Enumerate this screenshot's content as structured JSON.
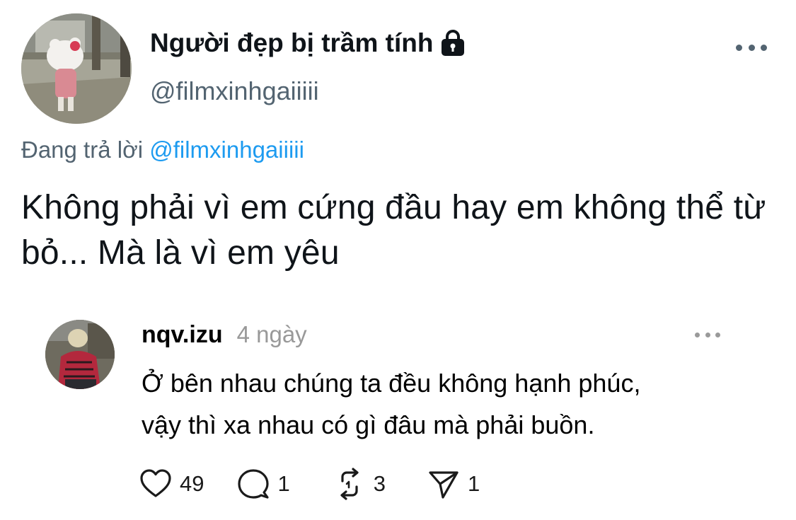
{
  "tweet": {
    "display_name": "Người đẹp bị trầm tính",
    "handle": "@filmxinhgaiiiii",
    "replying_prefix": "Đang trả lời",
    "replying_to": "@filmxinhgaiiiii",
    "text": "Không phải vì em cứng đầu hay em không thể từ bỏ... Mà là vì em yêu",
    "avatar_icon": "hello-kitty-photo",
    "protected_icon": "lock-icon",
    "more_icon": "more-horizontal-icon"
  },
  "embedded_reply": {
    "username": "nqv.izu",
    "time": "4 ngày",
    "text_line1": "Ở bên nhau chúng ta đều không hạnh phúc,",
    "text_line2": "vậy thì xa nhau có gì đâu mà phải buồn.",
    "avatar_icon": "person-photo",
    "actions": {
      "likes": "49",
      "comments": "1",
      "reposts": "3",
      "shares": "1"
    }
  },
  "colors": {
    "primary_text": "#0f1419",
    "secondary_text": "#536471",
    "link": "#1d9bf0",
    "muted": "#999999"
  }
}
